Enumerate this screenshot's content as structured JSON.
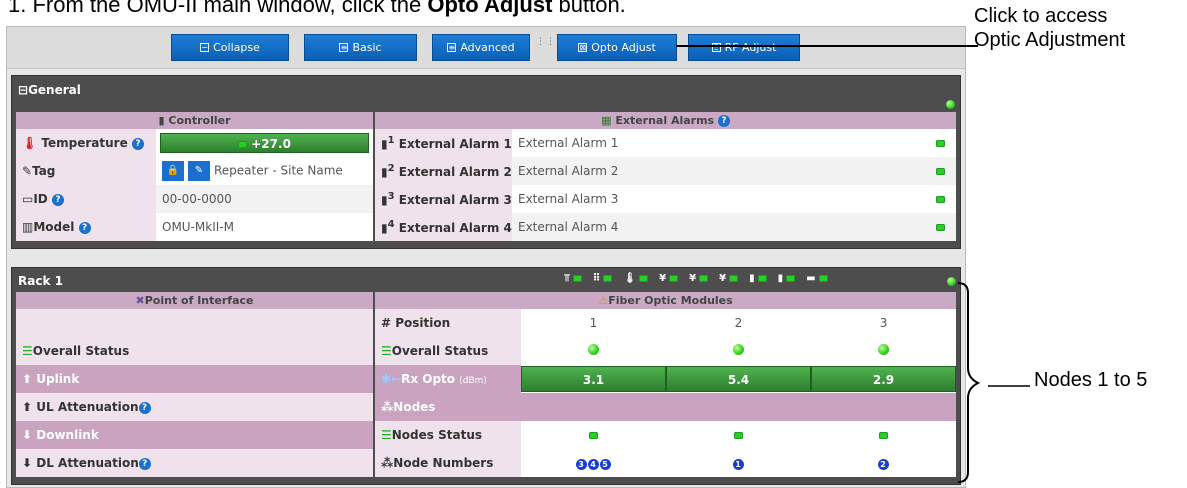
{
  "instruction": {
    "prefix": "1.  From the OMU-II main window, click the ",
    "bold": "Opto Adjust",
    "suffix": " button."
  },
  "toolbar": {
    "collapse": "Collapse",
    "basic": "Basic",
    "advanced": "Advanced",
    "opto_adjust": "Opto Adjust",
    "rf_adjust": "RF Adjust"
  },
  "general": {
    "title": "General",
    "controller_header": "Controller",
    "external_alarms_header": "External Alarms",
    "rows": [
      {
        "label": "Temperature",
        "value": "+27.0"
      },
      {
        "label": "Tag",
        "value": "Repeater - Site Name"
      },
      {
        "label": "ID",
        "value": "00-00-0000"
      },
      {
        "label": "Model",
        "value": "OMU-MkII-M"
      }
    ],
    "alarms": [
      {
        "sup": "1",
        "label": "External Alarm 1",
        "value": "External Alarm 1"
      },
      {
        "sup": "2",
        "label": "External Alarm 2",
        "value": "External Alarm 2"
      },
      {
        "sup": "3",
        "label": "External Alarm 3",
        "value": "External Alarm 3"
      },
      {
        "sup": "4",
        "label": "External Alarm 4",
        "value": "External Alarm 4"
      }
    ]
  },
  "rack": {
    "title": "Rack 1",
    "poi_header": "Point of Interface",
    "fom_header": "Fiber Optic Modules",
    "poi_rows": [
      "Overall Status",
      "Uplink",
      "UL Attenuation",
      "Downlink",
      "DL Attenuation"
    ],
    "position_label": "Position",
    "positions": [
      "1",
      "2",
      "3"
    ],
    "overall_status_label": "Overall Status",
    "rx_label": "Rx Opto",
    "rx_unit": "(dBm)",
    "rx_values": [
      "3.1",
      "5.4",
      "2.9"
    ],
    "nodes_label": "Nodes",
    "nodes_status_label": "Nodes Status",
    "node_numbers_label": "Node Numbers",
    "node_numbers": [
      [
        "3",
        "4",
        "5"
      ],
      [
        "1"
      ],
      [
        "2"
      ]
    ]
  },
  "annotations": {
    "opto_line1": "Click to access",
    "opto_line2": "Optic Adjustment",
    "nodes": "Nodes 1 to 5"
  },
  "colors": {
    "button_blue": "#0a5fb5",
    "panel_dark": "#4d4d4d",
    "header_mauve": "#c9a9c3",
    "status_green": "#2fcf1b"
  }
}
